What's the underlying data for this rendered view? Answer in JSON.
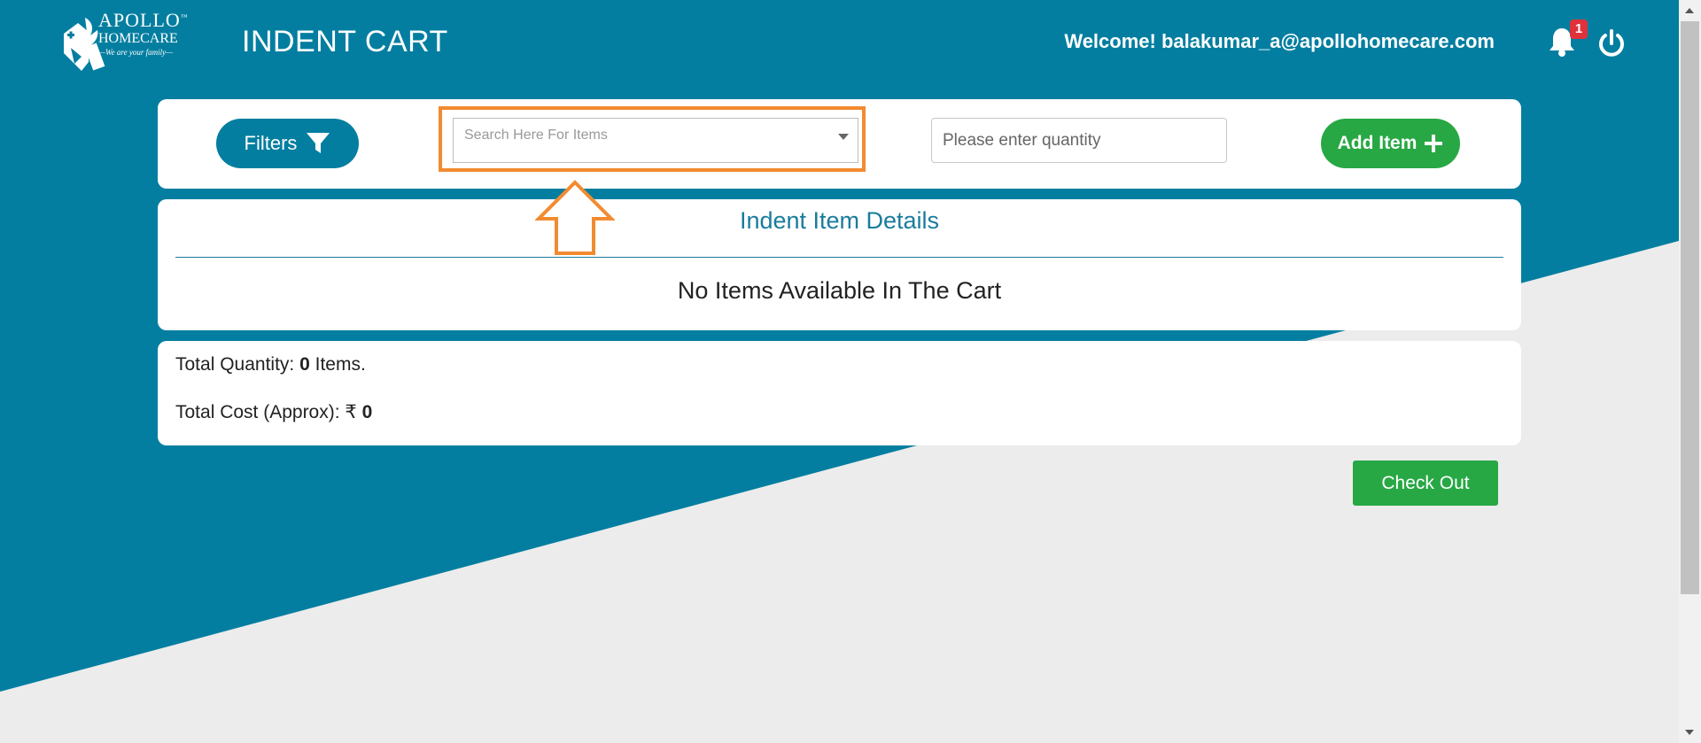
{
  "colors": {
    "primary_teal": "#037ea0",
    "background_gray": "#ececec",
    "accent_green": "#27a844",
    "highlight_orange": "#f28b30",
    "badge_red": "#e0323a"
  },
  "brand": {
    "name": "APOLLO",
    "trademark": "™",
    "sub": "HOMECARE",
    "tagline": "—We are your family—"
  },
  "header": {
    "title": "INDENT CART",
    "welcome": "Welcome! balakumar_a@apollohomecare.com",
    "notification_count": "1",
    "icons": [
      "bell-icon",
      "power-icon"
    ]
  },
  "toolbar": {
    "filters_label": "Filters",
    "search_placeholder": "Search Here For Items",
    "quantity_placeholder": "Please enter quantity",
    "add_item_label": "Add Item"
  },
  "details": {
    "title": "Indent Item Details",
    "empty_message": "No Items Available In The Cart"
  },
  "totals": {
    "quantity_label": "Total Quantity:",
    "quantity_value": "0",
    "quantity_suffix": "Items.",
    "cost_label": "Total Cost (Approx):",
    "currency_symbol": "₹",
    "cost_value": "0"
  },
  "checkout_label": "Check Out"
}
